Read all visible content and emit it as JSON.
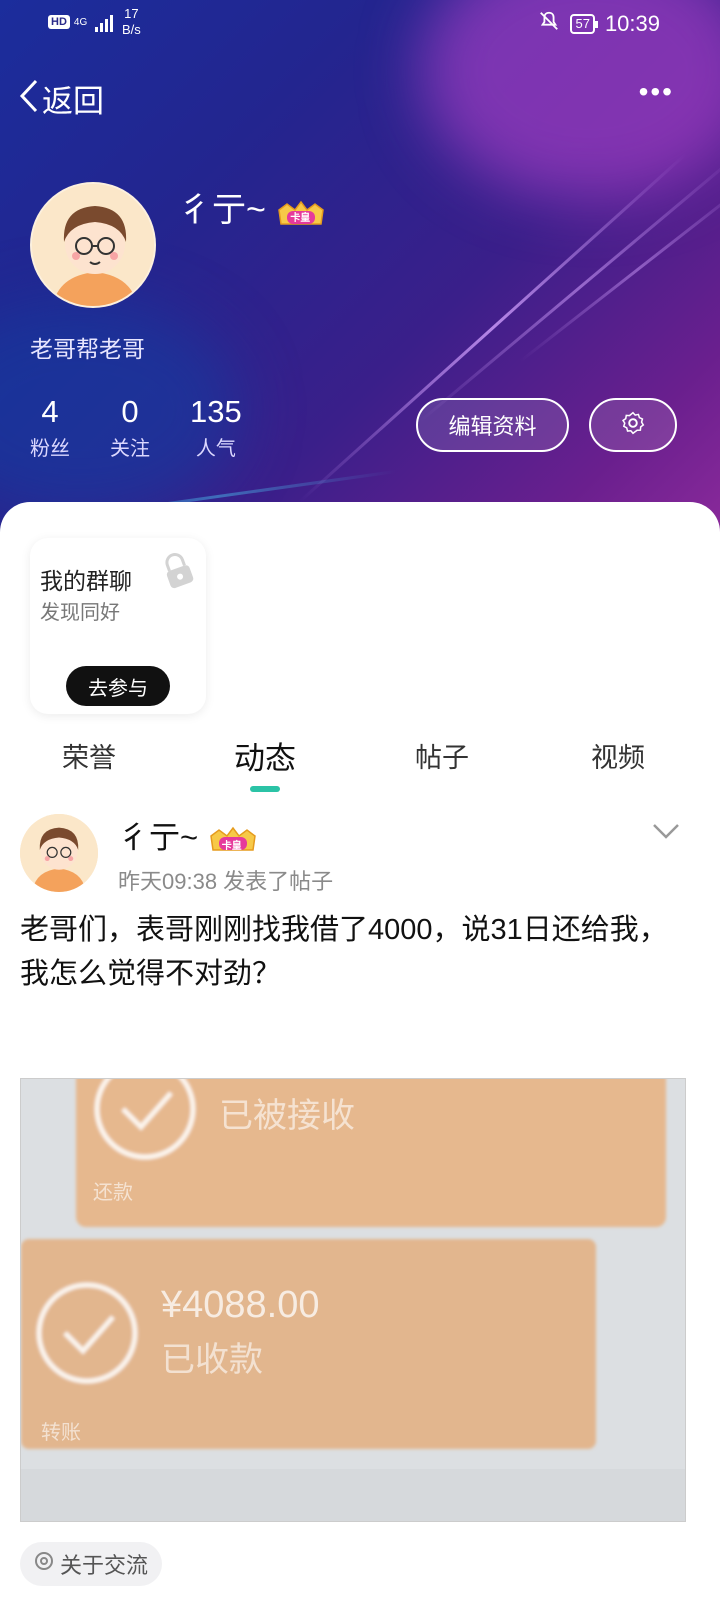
{
  "status_bar": {
    "hd": "HD",
    "network": "4G",
    "speed_value": "17",
    "speed_unit": "B/s",
    "battery": "57",
    "time": "10:39"
  },
  "nav": {
    "back_label": "返回",
    "more_label": "•••"
  },
  "profile": {
    "username": "彳亍~",
    "crown_badge": "卡皇",
    "signature": "老哥帮老哥",
    "stats": [
      {
        "value": "4",
        "label": "粉丝"
      },
      {
        "value": "0",
        "label": "关注"
      },
      {
        "value": "135",
        "label": "人气"
      }
    ],
    "edit_button": "编辑资料"
  },
  "group_card": {
    "title": "我的群聊",
    "subtitle": "发现同好",
    "button": "去参与"
  },
  "tabs": [
    {
      "label": "荣誉"
    },
    {
      "label": "动态"
    },
    {
      "label": "帖子"
    },
    {
      "label": "视频"
    }
  ],
  "post": {
    "author": "彳亍~",
    "crown_badge": "卡皇",
    "meta": "昨天09:38  发表了帖子",
    "text": "老哥们，表哥刚刚找我借了4000，说31日还给我，我怎么觉得不对劲？",
    "image": {
      "receipt1_status": "已被接收",
      "receipt1_tag": "还款",
      "receipt2_amount": "¥4088.00",
      "receipt2_status": "已收款",
      "receipt2_tag": "转账"
    },
    "topic": "关于交流"
  },
  "colors": {
    "accent": "#2bc3a6",
    "header_gradient_start": "#1b2d9c",
    "header_gradient_end": "#8b2a9b"
  }
}
